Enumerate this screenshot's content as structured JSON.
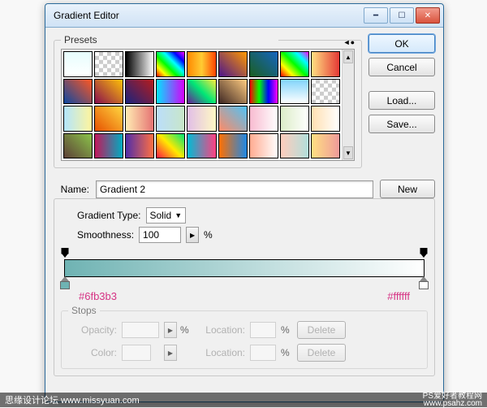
{
  "window": {
    "title": "Gradient Editor"
  },
  "buttons": {
    "ok": "OK",
    "cancel": "Cancel",
    "load": "Load...",
    "save": "Save...",
    "new": "New",
    "delete": "Delete"
  },
  "presets": {
    "label": "Presets",
    "swatches": [
      "linear-gradient(#e7fefe,#ffffff)",
      "repeating-conic-gradient(#ccc 0 25%, #fff 0 50%) 0/10px 10px",
      "linear-gradient(to right,#000,#fff)",
      "linear-gradient(45deg,#ff0000,#ffff00,#00ff00,#00ffff,#0000ff,#ff00ff)",
      "linear-gradient(to right,#ff8800,#ffcc33,#ff4400)",
      "linear-gradient(45deg,#4a148c,#ff9800)",
      "linear-gradient(45deg,#1b5e20,#1565c0)",
      "linear-gradient(45deg,#ff0000,#ffff00,#00ff00,#00ffff,#ff00ff)",
      "linear-gradient(to right,#ffe082,#e53935)",
      "linear-gradient(45deg,#0d47a1,#ff5722)",
      "linear-gradient(45deg,#880e4f,#ffc107)",
      "linear-gradient(45deg,#1a237e,#b71c1c)",
      "linear-gradient(to right,#00e5ff,#d500f9)",
      "linear-gradient(45deg,#6a1b9a,#00e676,#ffeb3b)",
      "linear-gradient(45deg,#3e2723,#ffcc80)",
      "linear-gradient(to right,#ff0000,#00ff00,#0000ff,#ff00ff)",
      "linear-gradient(to bottom,#81d4fa,#ffffff), repeating-conic-gradient(#ccc 0 25%, #fff 0 50%) 0/10px 10px",
      "repeating-conic-gradient(#ccc 0 25%, #fff 0 50%) 0/10px 10px",
      "linear-gradient(to right,#b3e5fc,#fff59d)",
      "linear-gradient(45deg,#e65100,#ffd740)",
      "linear-gradient(to right,#ffecb3,#e57373)",
      "linear-gradient(to right,#bbdefb,#c8e6c9)",
      "linear-gradient(to right,#e1bee7,#fff9c4)",
      "linear-gradient(45deg,#ff8a65,#4fc3f7)",
      "linear-gradient(to right,#f8bbd0,#fff)",
      "linear-gradient(to right,#dcedc8,#fff)",
      "linear-gradient(to right,#ffe0b2,#fff)",
      "linear-gradient(45deg,#5d4037,#8bc34a)",
      "linear-gradient(to right,#c2185b,#00acc1)",
      "linear-gradient(to right,#512da8,#ff7043)",
      "linear-gradient(45deg,#ff1744,#ffea00,#00e676)",
      "linear-gradient(to right,#00bcd4,#ff4081)",
      "linear-gradient(to right,#ff6f00,#1e88e5)",
      "linear-gradient(to right,#ffab91,#fff)",
      "linear-gradient(to right,#ffccbc,#b2dfdb)",
      "linear-gradient(to right,#ffe082,#ef9a9a)"
    ]
  },
  "name": {
    "label": "Name:",
    "value": "Gradient 2"
  },
  "gradient": {
    "type_label": "Gradient Type:",
    "type_value": "Solid",
    "smoothness_label": "Smoothness:",
    "smoothness_value": "100",
    "percent": "%",
    "stops": [
      {
        "hex": "#6fb3b3",
        "pos": 0
      },
      {
        "hex": "#ffffff",
        "pos": 100
      }
    ]
  },
  "stops_panel": {
    "label": "Stops",
    "opacity": "Opacity:",
    "color": "Color:",
    "location": "Location:"
  },
  "chart_data": {
    "type": "gradient",
    "direction": "horizontal",
    "color_stops": [
      {
        "position_pct": 0,
        "color": "#6fb3b3"
      },
      {
        "position_pct": 100,
        "color": "#ffffff"
      }
    ],
    "opacity_stops": [
      {
        "position_pct": 0,
        "opacity_pct": 100
      },
      {
        "position_pct": 100,
        "opacity_pct": 100
      }
    ],
    "smoothness_pct": 100,
    "gradient_type": "Solid"
  },
  "footer": {
    "left": "思缘设计论坛  www.missyuan.com",
    "right": "PS爱好者教程网\nwww.psahz.com"
  }
}
